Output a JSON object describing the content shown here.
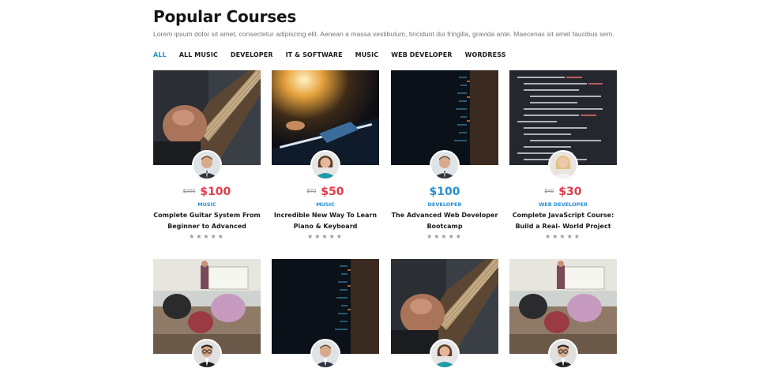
{
  "section": {
    "title": "Popular Courses",
    "subtitle": "Lorem ipsum dolor sit amet, consectetur adipiscing elit. Aenean a massa vestibulum, tincidunt dui fringilla, gravida ante. Maecenas sit amet faucibus sem."
  },
  "tabs": [
    {
      "label": "ALL",
      "active": true
    },
    {
      "label": "ALL MUSIC"
    },
    {
      "label": "DEVELOPER"
    },
    {
      "label": "IT & SOFTWARE"
    },
    {
      "label": "MUSIC"
    },
    {
      "label": "WEB DEVELOPER"
    },
    {
      "label": "WORDRESS"
    }
  ],
  "courses": [
    {
      "image": "guitar",
      "avatar": "man",
      "old_price": "$200",
      "price": "$100",
      "category": "MUSIC",
      "name": "Complete Guitar System From Beginner to Advanced",
      "stars": "★★★★★"
    },
    {
      "image": "piano",
      "avatar": "woman",
      "old_price": "$70",
      "price": "$50",
      "category": "MUSIC",
      "name": "Incredible New Way To Learn Piano & Keyboard",
      "stars": "★★★★★"
    },
    {
      "image": "code-dark",
      "avatar": "man",
      "old_price": "",
      "price": "$100",
      "category": "DEVELOPER",
      "name": "The Advanced Web Developer Bootcamp",
      "stars": "★★★★★"
    },
    {
      "image": "code-screen",
      "avatar": "woman-blonde",
      "old_price": "$40",
      "price": "$30",
      "category": "WEB DEVELOPER",
      "name": "Complete JavaScript Course: Build a Real- World Project",
      "stars": "★★★★★"
    },
    {
      "image": "classroom",
      "avatar": "man-glasses"
    },
    {
      "image": "code-dark",
      "avatar": "man"
    },
    {
      "image": "guitar",
      "avatar": "woman"
    },
    {
      "image": "classroom",
      "avatar": "man-glasses"
    }
  ],
  "colors": {
    "accent": "#2a8fd0",
    "price": "#e23b4a"
  }
}
